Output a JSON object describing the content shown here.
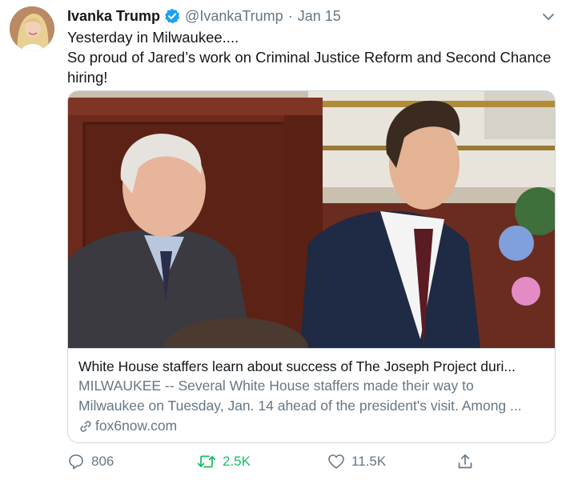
{
  "tweet": {
    "author_name": "Ivanka Trump",
    "handle": "@IvankaTrump",
    "separator": "·",
    "date": "Jan 15",
    "verified": true,
    "lines": [
      "Yesterday in Milwaukee....",
      "So proud of Jared’s work on Criminal Justice Reform and Second Chance",
      "hiring!"
    ]
  },
  "card": {
    "title": "White House staffers learn about success of The Joseph Project duri...",
    "description_lines": [
      "MILWAUKEE -- Several White House staffers made their way to",
      "Milwaukee on Tuesday, Jan. 14 ahead of the president's visit. Among ..."
    ],
    "domain": "fox6now.com"
  },
  "actions": {
    "reply_count": "806",
    "retweet_count": "2.5K",
    "like_count": "11.5K"
  },
  "icons": {
    "verified": "verified-badge-icon",
    "caret": "chevron-down-icon",
    "link": "link-icon",
    "reply": "reply-icon",
    "retweet": "retweet-icon",
    "like": "heart-icon",
    "share": "share-icon"
  },
  "colors": {
    "accent": "#1da1f2",
    "retweeted": "#17bf63",
    "secondary_text": "#657786",
    "border": "#ccd6dd"
  }
}
